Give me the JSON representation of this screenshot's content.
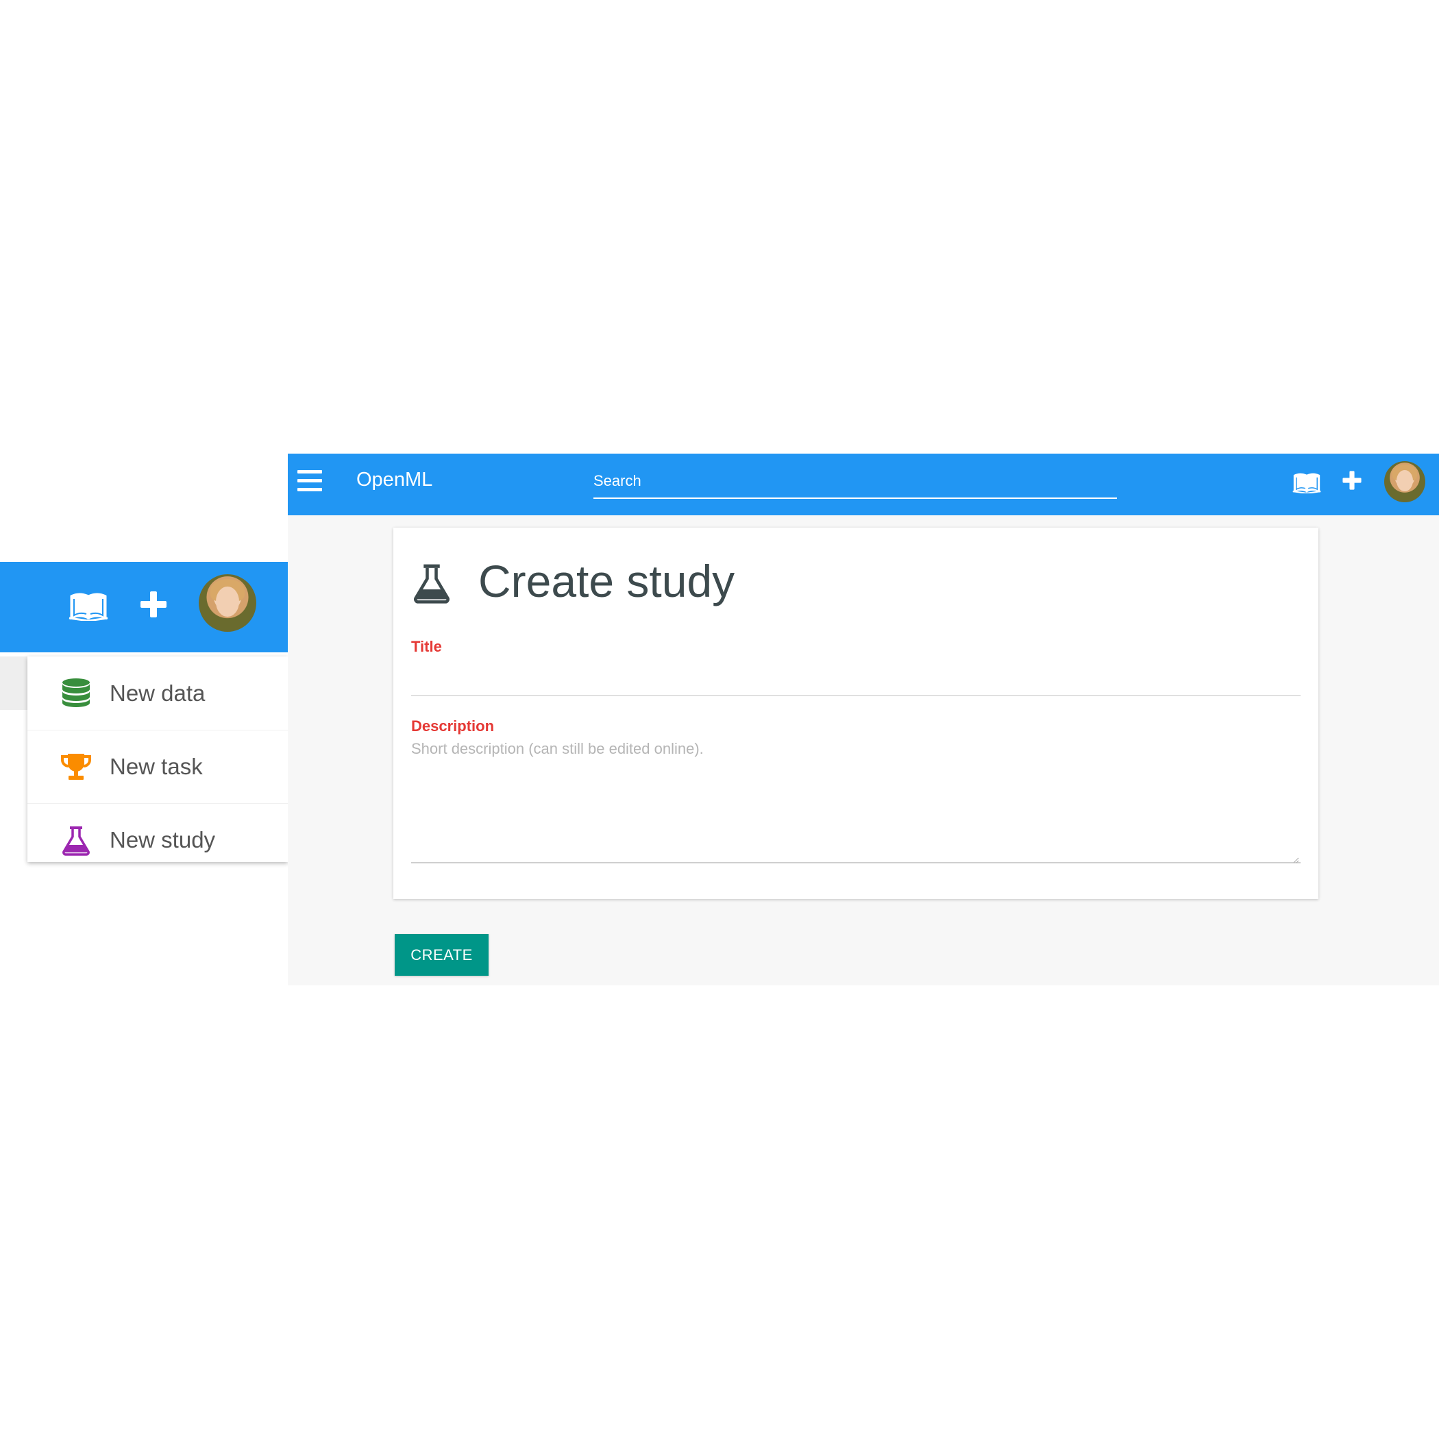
{
  "app": {
    "title": "OpenML",
    "search_placeholder": "Search",
    "primary_color": "#2196F3",
    "accent_color": "#009688",
    "icons": [
      "menu-icon",
      "book-icon",
      "plus-icon",
      "avatar"
    ]
  },
  "add_menu": {
    "items": [
      {
        "label": "New data",
        "icon": "database-icon",
        "color": "#388E3C"
      },
      {
        "label": "New task",
        "icon": "trophy-icon",
        "color": "#FB8C00"
      },
      {
        "label": "New study",
        "icon": "flask-icon",
        "color": "#9C27B0"
      }
    ]
  },
  "form": {
    "heading": "Create study",
    "heading_icon": "flask-icon",
    "title_label": "Title",
    "title_value": "",
    "description_label": "Description",
    "description_placeholder": "Short description (can still be edited online).",
    "description_value": "",
    "label_color": "#e53935",
    "submit_label": "CREATE"
  }
}
